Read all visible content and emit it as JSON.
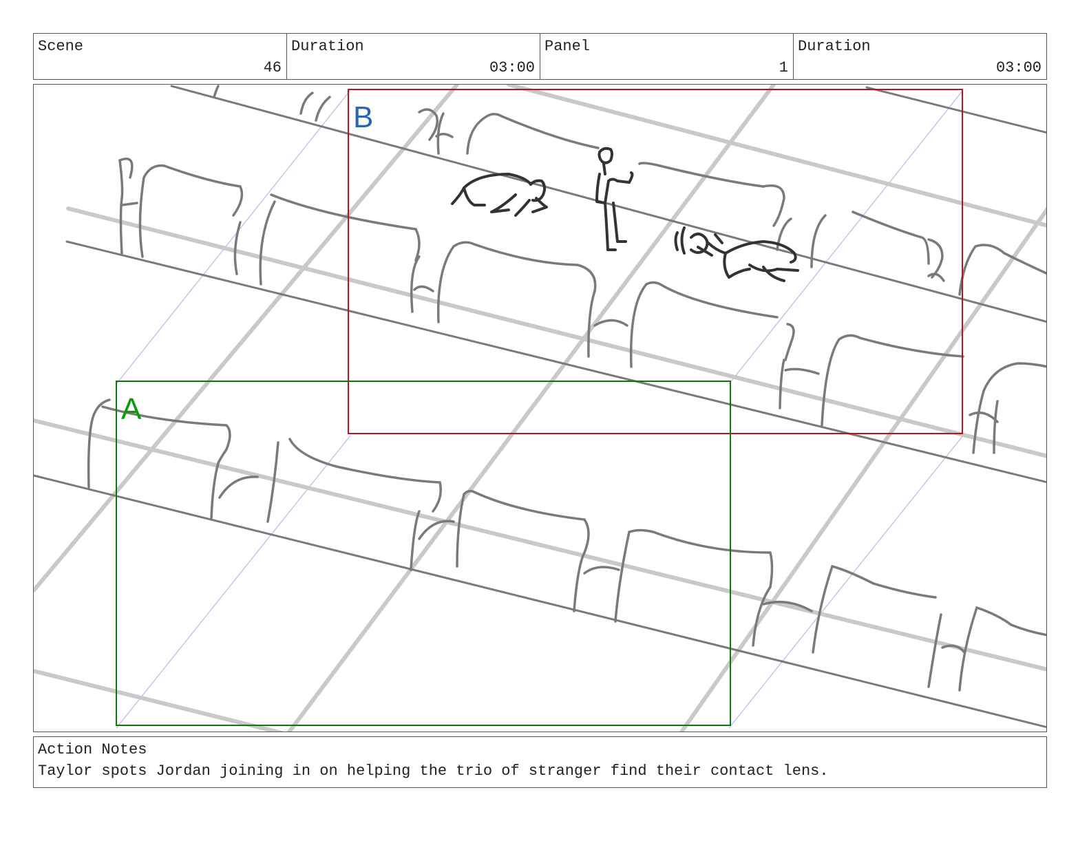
{
  "header": {
    "scene_label": "Scene",
    "scene_value": "46",
    "scene_duration_label": "Duration",
    "scene_duration_value": "03:00",
    "panel_label": "Panel",
    "panel_value": "1",
    "panel_duration_label": "Duration",
    "panel_duration_value": "03:00"
  },
  "frames": {
    "a_label": "A",
    "a_color": "#0a7a0a",
    "b_label": "B",
    "b_color": "#b3141e",
    "b_label_color": "#2a64b8"
  },
  "notes": {
    "title": "Action Notes",
    "text": "Taylor spots Jordan joining in on helping the trio of stranger find their contact lens."
  }
}
